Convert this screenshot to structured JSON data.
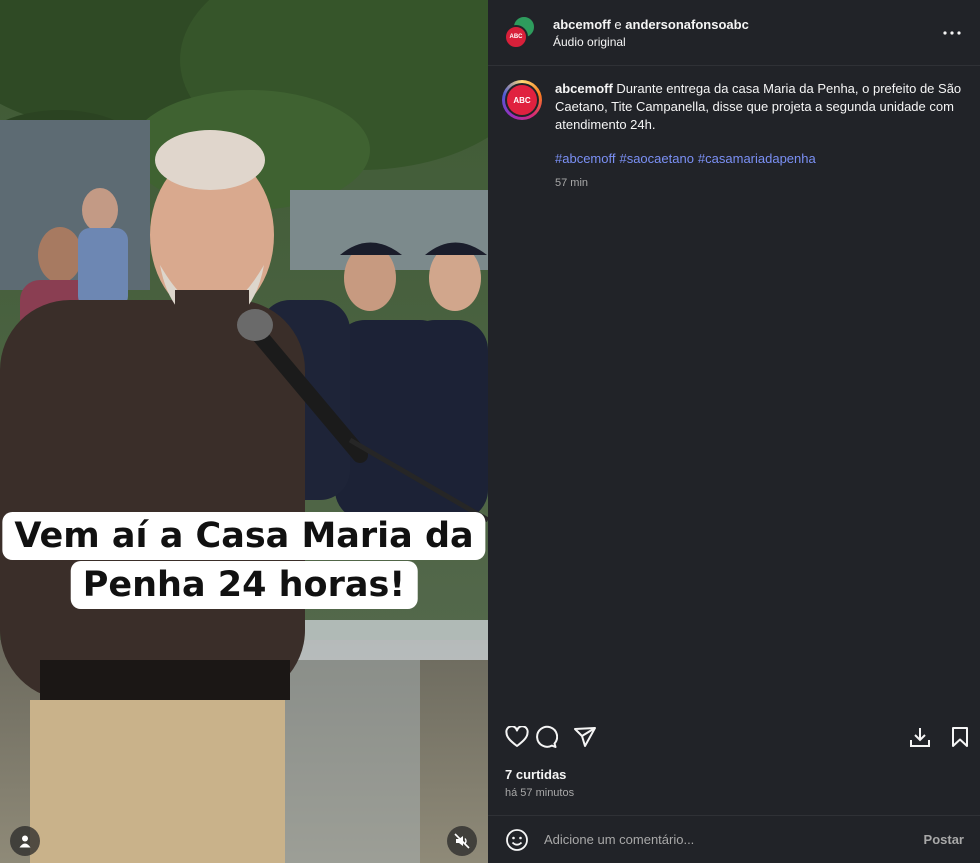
{
  "header": {
    "user1": "abcemoff",
    "conjunction": "e",
    "user2": "andersonafonsoabc",
    "audio": "Áudio original",
    "avatar_logo": "ABC"
  },
  "video": {
    "caption_line1": "Vem aí a Casa Maria da",
    "caption_line2": "Penha 24 horas!"
  },
  "post": {
    "username": "abcemoff",
    "text": "Durante entrega da casa Maria da Penha, o prefeito de São Caetano, Tite Campanella, disse que projeta a segunda unidade com atendimento 24h.",
    "hashtags": [
      "#abcemoff",
      "#saocaetano",
      "#casamariadapenha"
    ],
    "time": "57 min",
    "avatar_logo": "ABC"
  },
  "engagement": {
    "likes": "7 curtidas",
    "ago": "há 57 minutos"
  },
  "comment": {
    "placeholder": "Adicione um comentário...",
    "post_label": "Postar"
  },
  "icons": {
    "user": "user-icon",
    "mute": "muted-speaker-icon",
    "more": "more-options-icon",
    "like": "heart-icon",
    "comment": "comment-bubble-icon",
    "share": "send-icon",
    "download": "download-icon",
    "save": "bookmark-icon",
    "emoji": "emoji-icon"
  },
  "colors": {
    "panel_bg": "#212328",
    "hashtag": "#7b90f5",
    "muted_text": "#a8a8a8"
  }
}
